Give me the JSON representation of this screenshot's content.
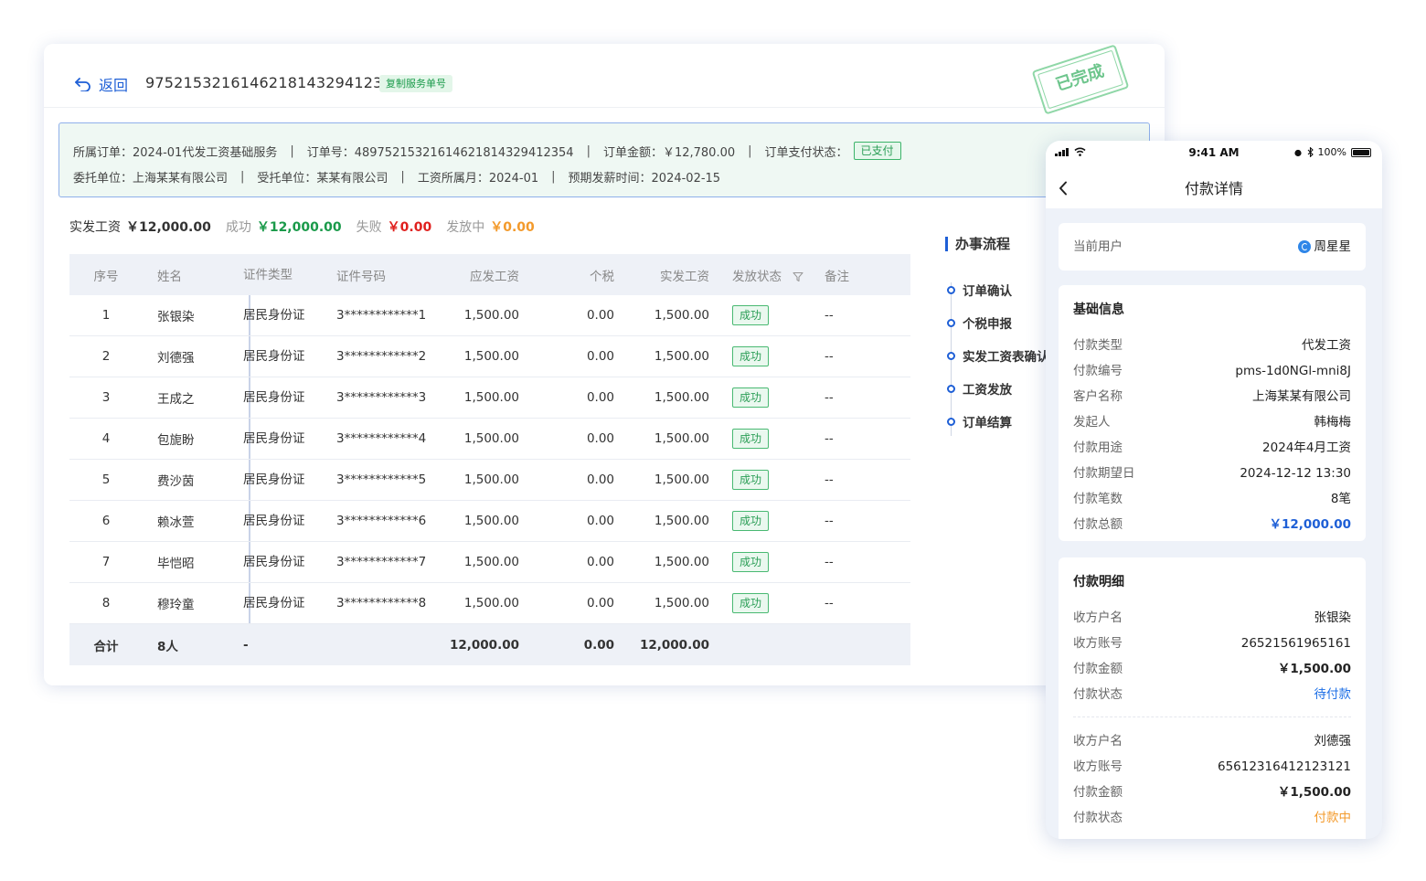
{
  "header": {
    "back_label": "返回",
    "order_no": "97521532161462181432941 2354",
    "copy_label": "复制服务单号",
    "stamp_text": "已完成"
  },
  "info": {
    "order_label": "所属订单：2024-01代发工资基础服务",
    "order_no_label": "订单号：48975215321614621814329412354",
    "amount_label": "订单金额：￥12,780.00",
    "pay_status_label": "订单支付状态：",
    "pay_status_value": "已支付",
    "client_label": "委托单位：上海某某有限公司",
    "trustee_label": "受托单位：某某有限公司",
    "month_label": "工资所属月：2024-01",
    "expect_label": "预期发薪时间：2024-02-15"
  },
  "summary": {
    "real_label": "实发工资",
    "real_value": "￥12,000.00",
    "success_label": "成功",
    "success_value": "￥12,000.00",
    "fail_label": "失败",
    "fail_value": "￥0.00",
    "pending_label": "发放中",
    "pending_value": "￥0.00"
  },
  "table": {
    "headers": {
      "idx": "序号",
      "name": "姓名",
      "type": "证件类型",
      "no": "证件号码",
      "should": "应发工资",
      "tax": "个税",
      "real": "实发工资",
      "status": "发放状态",
      "note": "备注"
    },
    "rows": [
      {
        "idx": "1",
        "name": "张银染",
        "type": "居民身份证",
        "no": "3************1",
        "should": "1,500.00",
        "tax": "0.00",
        "real": "1,500.00",
        "status": "成功",
        "note": "--"
      },
      {
        "idx": "2",
        "name": "刘德强",
        "type": "居民身份证",
        "no": "3************2",
        "should": "1,500.00",
        "tax": "0.00",
        "real": "1,500.00",
        "status": "成功",
        "note": "--"
      },
      {
        "idx": "3",
        "name": "王成之",
        "type": "居民身份证",
        "no": "3************3",
        "should": "1,500.00",
        "tax": "0.00",
        "real": "1,500.00",
        "status": "成功",
        "note": "--"
      },
      {
        "idx": "4",
        "name": "包旎盼",
        "type": "居民身份证",
        "no": "3************4",
        "should": "1,500.00",
        "tax": "0.00",
        "real": "1,500.00",
        "status": "成功",
        "note": "--"
      },
      {
        "idx": "5",
        "name": "费沙茵",
        "type": "居民身份证",
        "no": "3************5",
        "should": "1,500.00",
        "tax": "0.00",
        "real": "1,500.00",
        "status": "成功",
        "note": "--"
      },
      {
        "idx": "6",
        "name": "赖冰萱",
        "type": "居民身份证",
        "no": "3************6",
        "should": "1,500.00",
        "tax": "0.00",
        "real": "1,500.00",
        "status": "成功",
        "note": "--"
      },
      {
        "idx": "7",
        "name": "毕恺昭",
        "type": "居民身份证",
        "no": "3************7",
        "should": "1,500.00",
        "tax": "0.00",
        "real": "1,500.00",
        "status": "成功",
        "note": "--"
      },
      {
        "idx": "8",
        "name": "穆玲童",
        "type": "居民身份证",
        "no": "3************8",
        "should": "1,500.00",
        "tax": "0.00",
        "real": "1,500.00",
        "status": "成功",
        "note": "--"
      }
    ],
    "footer": {
      "idx": "合计",
      "name": "8人",
      "type": "-",
      "should": "12,000.00",
      "tax": "0.00",
      "real": "12,000.00"
    }
  },
  "process": {
    "title": "办事流程",
    "steps": [
      "订单确认",
      "个税申报",
      "实发工资表确认",
      "工资发放",
      "订单结算"
    ]
  },
  "phone": {
    "time": "9:41 AM",
    "battery": "100%",
    "title": "付款详情",
    "current_user_label": "当前用户",
    "current_user_value": "周星星",
    "basic_title": "基础信息",
    "basic": [
      {
        "k": "付款类型",
        "v": "代发工资"
      },
      {
        "k": "付款编号",
        "v": "pms-1d0NGl-mni8J"
      },
      {
        "k": "客户名称",
        "v": "上海某某有限公司"
      },
      {
        "k": "发起人",
        "v": "韩梅梅"
      },
      {
        "k": "付款用途",
        "v": "2024年4月工资"
      },
      {
        "k": "付款期望日",
        "v": "2024-12-12 13:30"
      },
      {
        "k": "付款笔数",
        "v": "8笔"
      },
      {
        "k": "付款总额",
        "v": "￥12,000.00"
      }
    ],
    "detail_title": "付款明细",
    "details": [
      [
        {
          "k": "收方户名",
          "v": "张银染"
        },
        {
          "k": "收方账号",
          "v": "26521561965161"
        },
        {
          "k": "付款金额",
          "v": "￥1,500.00"
        },
        {
          "k": "付款状态",
          "v": "待付款"
        }
      ],
      [
        {
          "k": "收方户名",
          "v": "刘德强"
        },
        {
          "k": "收方账号",
          "v": "65612316412123121"
        },
        {
          "k": "付款金额",
          "v": "￥1,500.00"
        },
        {
          "k": "付款状态",
          "v": "付款中"
        }
      ]
    ]
  },
  "colors": {
    "primary": "#1e5fd6",
    "success": "#1a9a4a",
    "danger": "#e0201e",
    "warning": "#f39a2b"
  }
}
